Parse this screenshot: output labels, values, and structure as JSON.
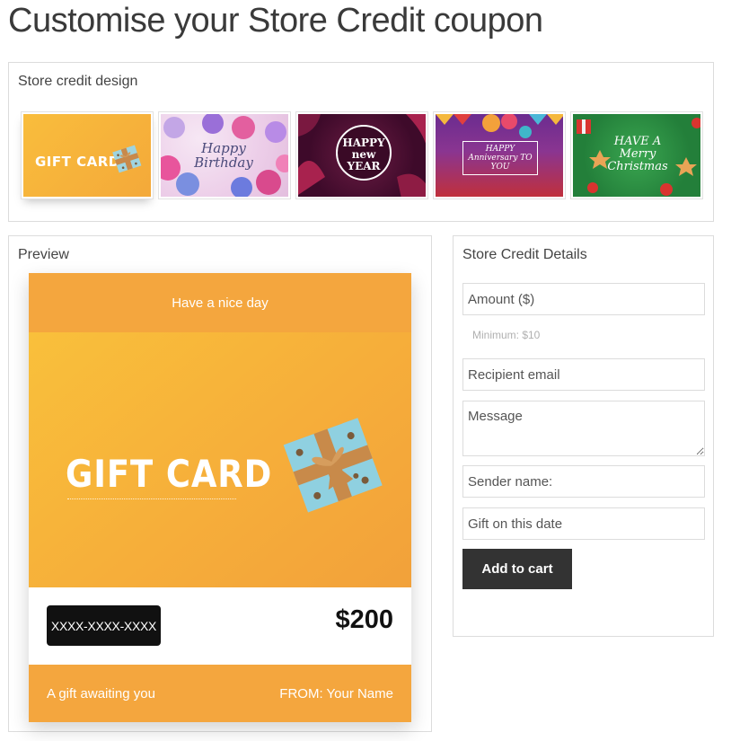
{
  "page": {
    "title": "Customise your Store Credit coupon"
  },
  "design": {
    "title": "Store credit design",
    "thumbnails": [
      {
        "name": "gift-card",
        "label": "GIFT CARD",
        "selected": true
      },
      {
        "name": "happy-birthday",
        "label": "Happy Birthday",
        "selected": false
      },
      {
        "name": "happy-new-year",
        "label": "HAPPY new YEAR",
        "selected": false
      },
      {
        "name": "happy-anniversary",
        "label": "HAPPY Anniversary TO YOU",
        "selected": false
      },
      {
        "name": "merry-christmas",
        "label": "HAVE A Merry Christmas",
        "selected": false
      }
    ]
  },
  "preview": {
    "title": "Preview",
    "top_message": "Have a nice day",
    "hero_title": "GIFT CARD",
    "code": "XXXX-XXXX-XXXX",
    "amount": "$200",
    "bottom_left": "A gift awaiting you",
    "bottom_right": "FROM: Your Name"
  },
  "details": {
    "title": "Store Credit Details",
    "amount_placeholder": "Amount ($)",
    "minimum_hint": "Minimum: $10",
    "recipient_placeholder": "Recipient email",
    "message_placeholder": "Message",
    "sender_placeholder": "Sender name:",
    "date_placeholder": "Gift on this date",
    "add_to_cart": "Add to cart"
  },
  "colors": {
    "accent_orange": "#f4a63e",
    "button_dark": "#333333"
  }
}
